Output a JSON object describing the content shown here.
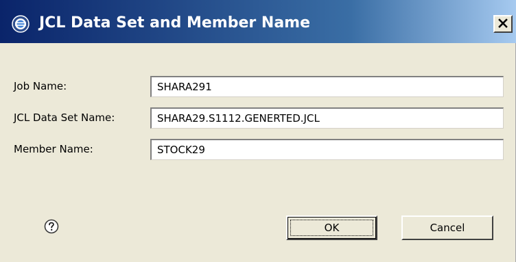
{
  "dialog": {
    "title": "JCL Data Set and Member Name",
    "title_icon": "eclipse-icon",
    "close_glyph": "×"
  },
  "form": {
    "job_name": {
      "label": "Job Name:",
      "value": "SHARA291"
    },
    "jcl_data_set_name": {
      "label": "JCL Data Set Name:",
      "value": "SHARA29.S1112.GENERTED.JCL"
    },
    "member_name": {
      "label": "Member Name:",
      "value": "STOCK29"
    }
  },
  "buttons": {
    "help_icon": "help-icon",
    "ok_label": "OK",
    "cancel_label": "Cancel"
  },
  "colors": {
    "title_gradient_start": "#0a246a",
    "title_gradient_end": "#a6caf0",
    "dialog_background": "#ece9d8"
  }
}
